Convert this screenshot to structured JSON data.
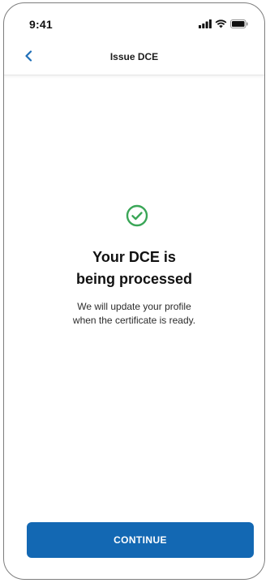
{
  "status_bar": {
    "time": "9:41",
    "icons": [
      "signal-icon",
      "wifi-icon",
      "battery-icon"
    ]
  },
  "nav": {
    "back_icon": "chevron-left-icon",
    "title": "Issue DCE"
  },
  "main": {
    "status_icon": "check-circle-icon",
    "headline_line1": "Your DCE is",
    "headline_line2": "being processed",
    "message_line1": "We will update your profile",
    "message_line2": "when the certificate is ready."
  },
  "footer": {
    "continue_label": "CONTINUE"
  },
  "colors": {
    "accent": "#1368b3",
    "back_chevron": "#1f6fb8",
    "success": "#3aa657",
    "text": "#111111"
  }
}
